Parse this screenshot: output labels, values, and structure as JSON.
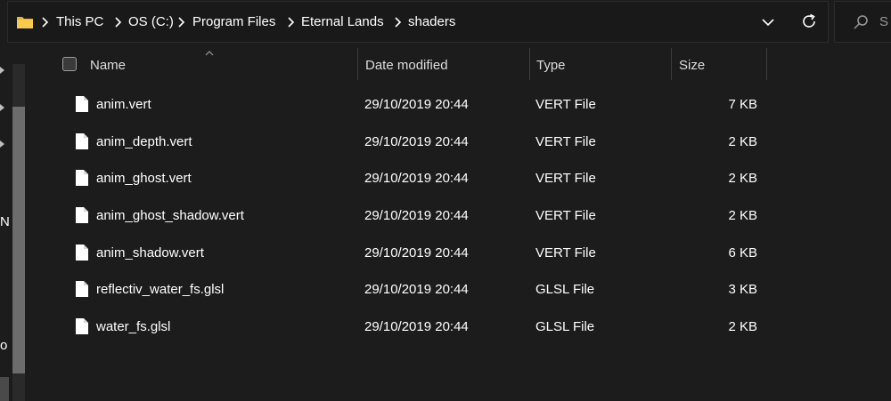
{
  "address_bar": {
    "breadcrumbs": [
      "This PC",
      "OS (C:)",
      "Program Files",
      "Eternal Lands",
      "shaders"
    ]
  },
  "search": {
    "placeholder": "S"
  },
  "nav_pane": {
    "partial_labels": [
      "N",
      "o"
    ]
  },
  "columns": {
    "name": "Name",
    "date_modified": "Date modified",
    "type": "Type",
    "size": "Size"
  },
  "files": [
    {
      "name": "anim.vert",
      "date": "29/10/2019 20:44",
      "type": "VERT File",
      "size": "7 KB"
    },
    {
      "name": "anim_depth.vert",
      "date": "29/10/2019 20:44",
      "type": "VERT File",
      "size": "2 KB"
    },
    {
      "name": "anim_ghost.vert",
      "date": "29/10/2019 20:44",
      "type": "VERT File",
      "size": "2 KB"
    },
    {
      "name": "anim_ghost_shadow.vert",
      "date": "29/10/2019 20:44",
      "type": "VERT File",
      "size": "2 KB"
    },
    {
      "name": "anim_shadow.vert",
      "date": "29/10/2019 20:44",
      "type": "VERT File",
      "size": "6 KB"
    },
    {
      "name": "reflectiv_water_fs.glsl",
      "date": "29/10/2019 20:44",
      "type": "GLSL File",
      "size": "3 KB"
    },
    {
      "name": "water_fs.glsl",
      "date": "29/10/2019 20:44",
      "type": "GLSL File",
      "size": "2 KB"
    }
  ],
  "colors": {
    "background": "#1c1c1c",
    "folder_icon": "#e8b33f",
    "text": "#ffffff"
  }
}
